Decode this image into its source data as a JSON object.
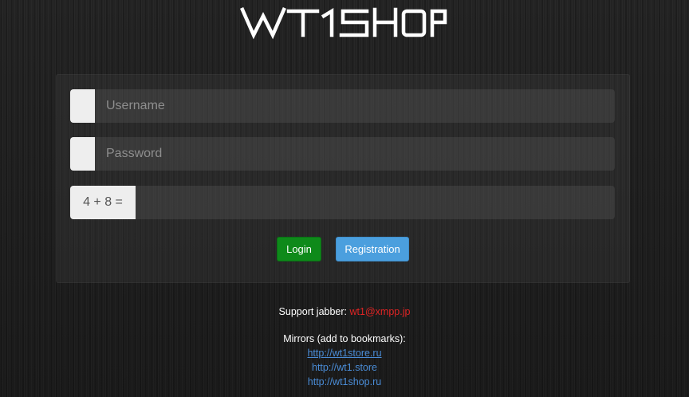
{
  "logo": {
    "text": "WT1SHOP"
  },
  "login_form": {
    "username_placeholder": "Username",
    "password_placeholder": "Password",
    "captcha_question": "4 + 8 =",
    "captcha_value": "",
    "login_label": "Login",
    "registration_label": "Registration"
  },
  "footer": {
    "support_label": "Support jabber:",
    "support_jabber": "wt1@xmpp.jp",
    "mirrors_label": "Mirrors (add to bookmarks):",
    "mirrors": [
      "http://wt1store.ru",
      "http://wt1.store",
      "http://wt1shop.ru"
    ]
  },
  "colors": {
    "login_button": "#0e8a1a",
    "registration_button": "#4b9fde",
    "jabber_text": "#e02424",
    "link": "#4a8cd6"
  }
}
